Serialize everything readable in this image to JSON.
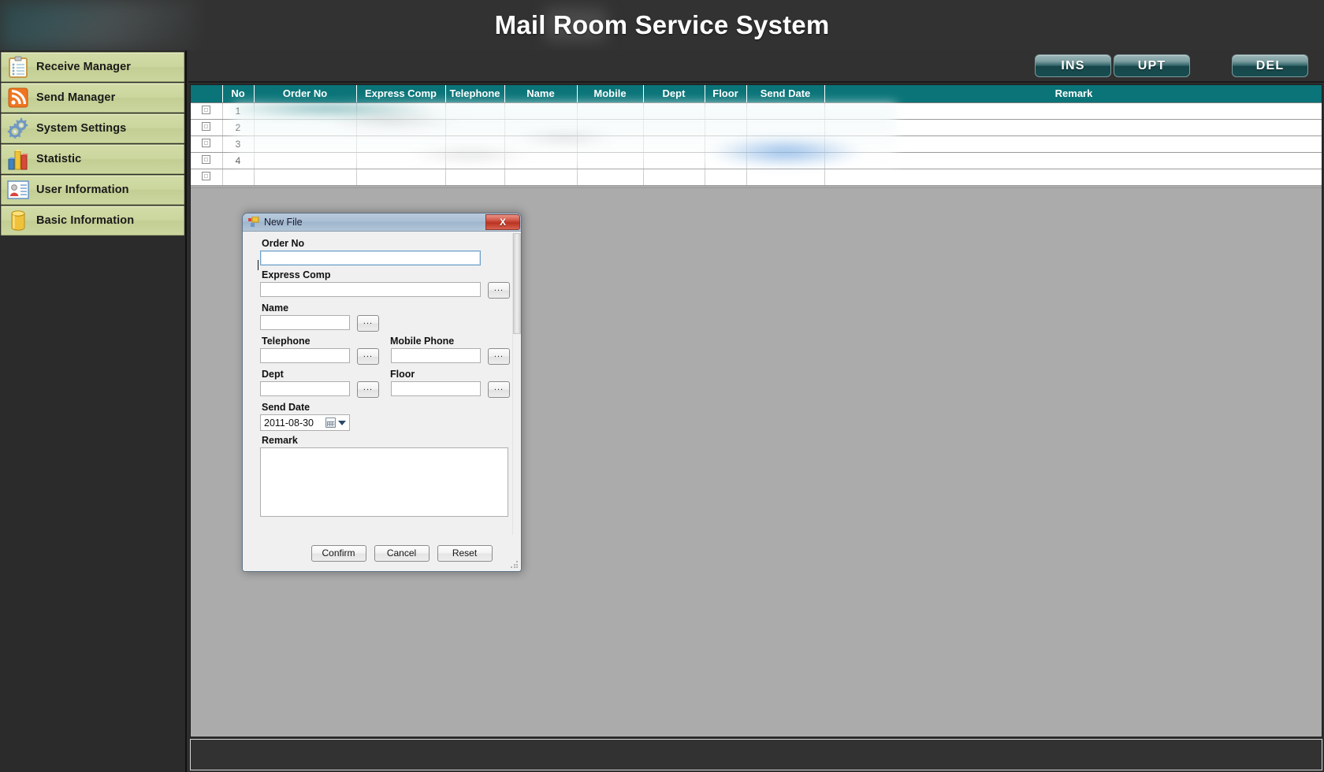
{
  "app": {
    "title": "Mail Room Service System"
  },
  "sidebar": {
    "items": [
      {
        "label": "Receive Manager",
        "icon": "clipboard-icon"
      },
      {
        "label": "Send Manager",
        "icon": "rss-feed-icon"
      },
      {
        "label": "System Settings",
        "icon": "gears-icon"
      },
      {
        "label": "Statistic",
        "icon": "bar-chart-icon"
      },
      {
        "label": "User Information",
        "icon": "user-card-icon"
      },
      {
        "label": "Basic Information",
        "icon": "database-cylinder-icon"
      }
    ]
  },
  "toolbar": {
    "insert_label": "INS",
    "update_label": "UPT",
    "delete_label": "DEL"
  },
  "grid": {
    "columns": [
      "",
      "No",
      "Order No",
      "Express Comp",
      "Telephone",
      "Name",
      "Mobile",
      "Dept",
      "Floor",
      "Send Date",
      "Remark"
    ],
    "rows": [
      {
        "no": "1",
        "order_no": "",
        "express_comp": "",
        "telephone": "",
        "name": "",
        "mobile": "",
        "dept": "",
        "floor": "",
        "send_date": "",
        "remark": ""
      },
      {
        "no": "2",
        "order_no": "",
        "express_comp": "",
        "telephone": "",
        "name": "",
        "mobile": "",
        "dept": "",
        "floor": "",
        "send_date": "",
        "remark": ""
      },
      {
        "no": "3",
        "order_no": "",
        "express_comp": "",
        "telephone": "",
        "name": "",
        "mobile": "",
        "dept": "",
        "floor": "",
        "send_date": "",
        "remark": ""
      },
      {
        "no": "4",
        "order_no": "",
        "express_comp": "",
        "telephone": "",
        "name": "",
        "mobile": "",
        "dept": "",
        "floor": "",
        "send_date": "",
        "remark": ""
      },
      {
        "no": "",
        "order_no": "",
        "express_comp": "",
        "telephone": "",
        "name": "",
        "mobile": "",
        "dept": "",
        "floor": "",
        "send_date": "",
        "remark": ""
      }
    ]
  },
  "dialog": {
    "title": "New File",
    "close_label": "X",
    "ellipsis_label": "...",
    "fields": {
      "order_no_label": "Order No",
      "order_no_value": "",
      "express_comp_label": "Express Comp",
      "express_comp_value": "",
      "name_label": "Name",
      "name_value": "",
      "telephone_label": "Telephone",
      "telephone_value": "",
      "mobile_phone_label": "Mobile Phone",
      "mobile_phone_value": "",
      "dept_label": "Dept",
      "dept_value": "",
      "floor_label": "Floor",
      "floor_value": "",
      "send_date_label": "Send Date",
      "send_date_value": "2011-08-30",
      "remark_label": "Remark",
      "remark_value": ""
    },
    "buttons": {
      "confirm_label": "Confirm",
      "cancel_label": "Cancel",
      "reset_label": "Reset"
    }
  },
  "colors": {
    "accent_teal": "#0a7478",
    "sidebar_green": "#cbd69e",
    "header_dark": "#323232",
    "dialog_title_blue": "#aabfd4",
    "close_red": "#b93322"
  }
}
